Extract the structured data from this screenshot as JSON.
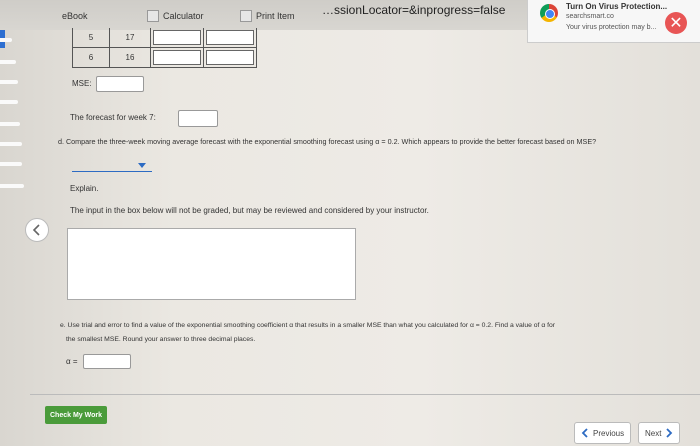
{
  "browser": {
    "url_fragment": "…ssionLocator=&inprogress=false",
    "tabs": [
      "eBook",
      "Calculator",
      "Print Item"
    ]
  },
  "notification": {
    "title": "Turn On Virus Protection...",
    "source": "searchsmart.co",
    "message": "Your virus protection may b..."
  },
  "table": {
    "rows": [
      {
        "period": "5",
        "value": "17"
      },
      {
        "period": "6",
        "value": "16"
      }
    ]
  },
  "question": {
    "mse_label": "MSE:",
    "forecast_week7_label": "The forecast for week 7:",
    "part_d": "d. Compare the three-week moving average forecast with the exponential smoothing forecast using α = 0.2. Which appears to provide the better forecast based on MSE?",
    "explain_label": "Explain.",
    "explain_note": "The input in the box below will not be graded, but may be reviewed and considered by your instructor.",
    "part_e_line1": "e. Use trial and error to find a value of the exponential smoothing coefficient α that results in a smaller MSE than what you calculated for α = 0.2. Find a value of α for",
    "part_e_line2": "the smallest MSE. Round your answer to three decimal places.",
    "alpha_label": "α ="
  },
  "footer": {
    "check_label": "Check My Work",
    "previous_label": "Previous",
    "next_label": "Next"
  },
  "colors": {
    "check_button": "#4a9b3a",
    "dropdown_accent": "#2d6bc3",
    "close_button": "#e85555"
  }
}
